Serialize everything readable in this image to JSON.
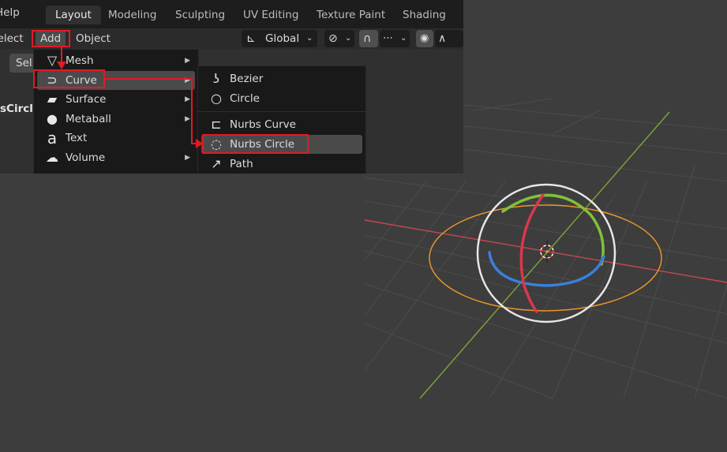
{
  "workspace_tabs": [
    "Layout",
    "Modeling",
    "Sculpting",
    "UV Editing",
    "Texture Paint",
    "Shading"
  ],
  "top_menu": {
    "help": "Help"
  },
  "header": {
    "select": "Select",
    "add": "Add",
    "object": "Object",
    "transform_orientation": "Global"
  },
  "toolbar": {
    "select_button": "Sel"
  },
  "object_name_partial": "sCircle",
  "add_menu": {
    "items": [
      {
        "label": "Mesh",
        "icon": "mesh-icon"
      },
      {
        "label": "Curve",
        "icon": "curve-icon"
      },
      {
        "label": "Surface",
        "icon": "surface-icon"
      },
      {
        "label": "Metaball",
        "icon": "metaball-icon"
      },
      {
        "label": "Text",
        "icon": "text-icon"
      },
      {
        "label": "Volume",
        "icon": "volume-icon"
      }
    ],
    "highlighted": "Curve"
  },
  "curve_submenu": {
    "items": [
      {
        "label": "Bezier",
        "icon": "bezier-icon"
      },
      {
        "label": "Circle",
        "icon": "circle-curve-icon"
      },
      {
        "label": "Nurbs Curve",
        "icon": "nurbs-curve-icon"
      },
      {
        "label": "Nurbs Circle",
        "icon": "nurbs-circle-icon"
      },
      {
        "label": "Path",
        "icon": "path-icon"
      }
    ],
    "highlighted": "Nurbs Circle"
  },
  "colors": {
    "annotation": "#e01b24",
    "x_axis": "#c8484f",
    "y_axis": "#7ea53a",
    "nurbs_circle": "#e8962a",
    "gizmo_ring": "#e6e6e6",
    "gizmo_red": "#d9384a",
    "gizmo_green": "#7fc23a",
    "gizmo_blue": "#3a7fd9"
  }
}
